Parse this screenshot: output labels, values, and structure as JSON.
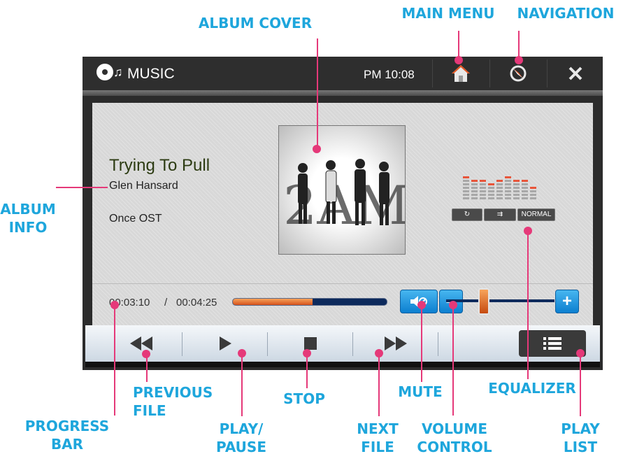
{
  "callouts": {
    "main_menu": "MAIN MENU",
    "navigation": "NAVIGATION",
    "album_cover": "ALBUM COVER",
    "album_info_1": "ALBUM",
    "album_info_2": "INFO",
    "progress_bar_1": "PROGRESS",
    "progress_bar_2": "BAR",
    "previous_file_1": "PREVIOUS",
    "previous_file_2": "FILE",
    "play_pause_1": "PLAY/",
    "play_pause_2": "PAUSE",
    "stop": "STOP",
    "next_file_1": "NEXT",
    "next_file_2": "FILE",
    "mute": "MUTE",
    "volume_control_1": "VOLUME",
    "volume_control_2": "CONTROL",
    "equalizer": "EQUALIZER",
    "play_list_1": "PLAY",
    "play_list_2": "LIST"
  },
  "titlebar": {
    "title": "MUSIC",
    "clock": "PM 10:08",
    "icons": [
      "music-logo-icon",
      "home-icon",
      "navigation-icon",
      "close-icon"
    ]
  },
  "track": {
    "title": "Trying To Pull",
    "artist": "Glen Hansard",
    "album": "Once OST",
    "cover_text": "2AM"
  },
  "equalizer": {
    "levels": [
      0.5,
      0.45,
      0.45,
      0.35,
      0.45,
      0.5,
      0.45,
      0.4,
      0.25
    ],
    "repeat_label": "",
    "shuffle_label": "",
    "mode_label": "NORMAL"
  },
  "playback": {
    "current_time": "00:03:10",
    "separator": "/",
    "total_time": "00:04:25",
    "progress": 0.52
  },
  "volume": {
    "level": 0.35
  },
  "colors": {
    "accent_callout": "#1ea6dc",
    "callout_line": "#e53979",
    "progress_fill": "#e2712b",
    "button_blue": "#1e94e0"
  }
}
